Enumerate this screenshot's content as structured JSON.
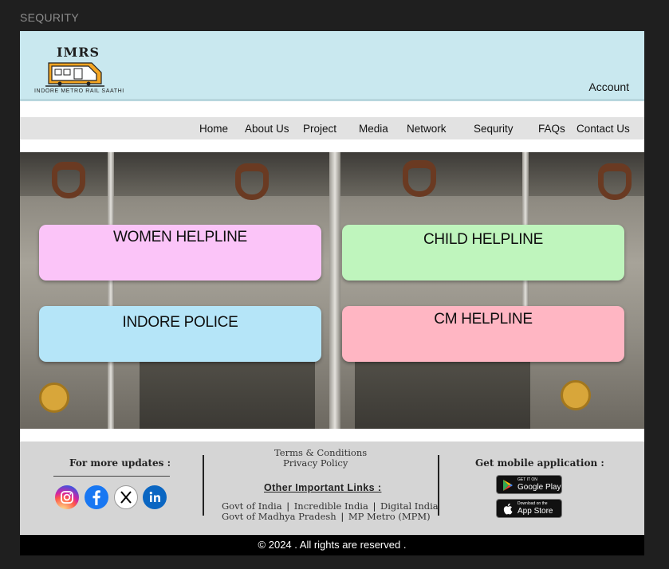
{
  "page_label": "SEQURITY",
  "header": {
    "logo_title": "IMRS",
    "logo_caption": "INDORE METRO RAIL SAATHI",
    "account_label": "Account"
  },
  "nav": {
    "items": [
      "Home",
      "About Us",
      "Project",
      "Media",
      "Network",
      "Sequrity",
      "FAQs",
      "Contact Us"
    ]
  },
  "cards": [
    {
      "label": "WOMEN HELPLINE",
      "color": "#fbc4f8"
    },
    {
      "label": "CHILD HELPLINE",
      "color": "#bff5bd"
    },
    {
      "label": "INDORE POLICE",
      "color": "#b5e5f8"
    },
    {
      "label": "CM HELPLINE",
      "color": "#ffb6c3"
    }
  ],
  "footer": {
    "updates_heading": "For more updates :",
    "social": [
      {
        "icon": "instagram-icon",
        "color": "#d6249f"
      },
      {
        "icon": "facebook-icon",
        "color": "#1877f2"
      },
      {
        "icon": "x-icon",
        "color": "#000000"
      },
      {
        "icon": "linkedin-icon",
        "color": "#0a66c2"
      }
    ],
    "terms": "Terms & Conditions",
    "privacy": "Privacy Policy",
    "other_links_heading": "Other Important Links :",
    "links_row1": [
      "Govt of India",
      "Incredible India",
      "Digital India"
    ],
    "links_row2": [
      "Govt of Madhya Pradesh",
      "MP Metro (MPM)"
    ],
    "separator": "|",
    "mobile_heading": "Get mobile application :",
    "google_play": {
      "small": "GET IT ON",
      "big": "Google Play"
    },
    "app_store": {
      "small": "Download on the",
      "big": "App Store"
    }
  },
  "copyright": "© 2024 . All rights are reserved ."
}
